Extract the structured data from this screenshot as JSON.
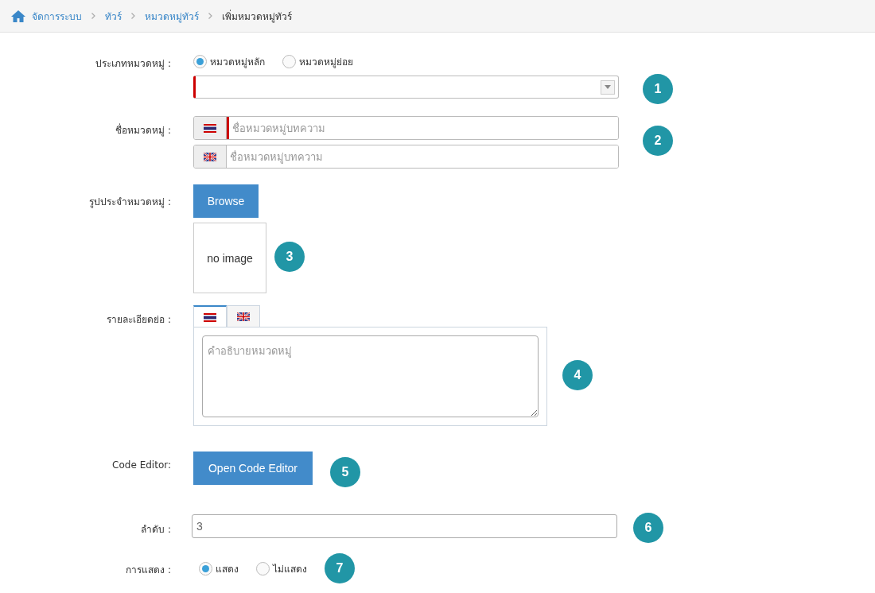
{
  "breadcrumb": [
    {
      "label": "จัดการระบบ",
      "current": false
    },
    {
      "label": "ทัวร์",
      "current": false
    },
    {
      "label": "หมวดหมู่ทัวร์",
      "current": false
    },
    {
      "label": "เพิ่มหมวดหมู่ทัวร์",
      "current": true
    }
  ],
  "form": [
    {
      "kind": "type",
      "label": "ประเภทหมวดหมู่ :",
      "options": [
        {
          "label": "หมวดหมู่หลัก",
          "selected": true
        },
        {
          "label": "หมวดหมู่ย่อย",
          "selected": false
        }
      ],
      "required": true,
      "badge": "1"
    },
    {
      "kind": "names",
      "label": "ชื่อหมวดหมู่ :",
      "inputs": [
        {
          "kind": "thai",
          "placeholder": "ชื่อหมวดหมู่บทความ",
          "required": true
        },
        {
          "kind": "english",
          "placeholder": "ชื่อหมวดหมู่บทความ",
          "required": false
        }
      ],
      "badge": "2"
    },
    {
      "kind": "image",
      "label": "รูปประจำหมวดหมู่ :",
      "button": "Browse",
      "preview": "no image",
      "badge": "3"
    },
    {
      "kind": "description",
      "label": "รายละเอียดย่อ :",
      "tabs": [
        {
          "kind": "thai",
          "selected": true
        },
        {
          "kind": "english",
          "selected": false
        }
      ],
      "placeholder": "คำอธิบายหมวดหมู่",
      "badge": "4"
    },
    {
      "kind": "code",
      "label": "Code Editor:",
      "button": "Open Code Editor",
      "badge": "5"
    },
    {
      "kind": "order",
      "label": "ลำดับ :",
      "value": "3",
      "badge": "6"
    },
    {
      "kind": "display",
      "label": "การแสดง :",
      "options": [
        {
          "label": "แสดง",
          "selected": true
        },
        {
          "label": "ไม่แสดง",
          "selected": false
        }
      ],
      "badge": "7"
    }
  ]
}
